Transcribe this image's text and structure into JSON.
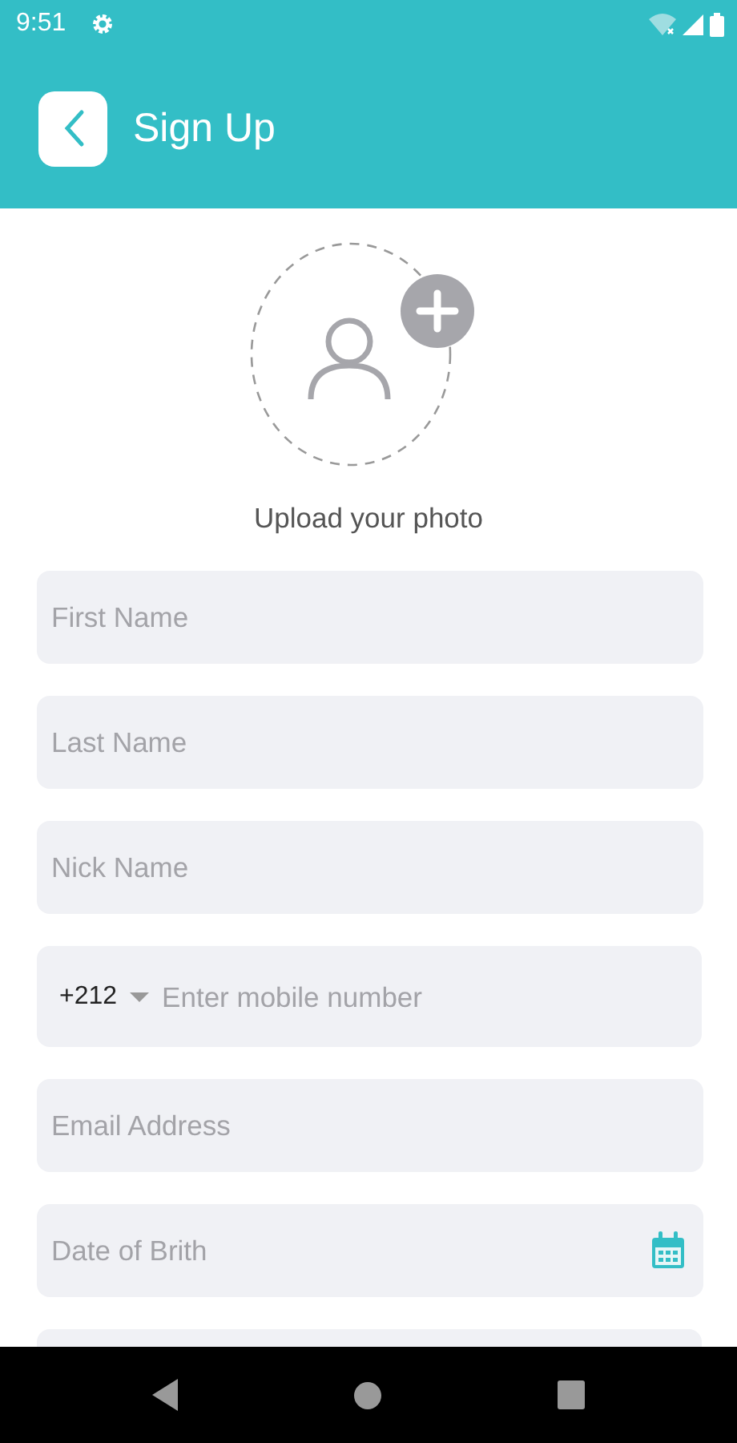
{
  "status_bar": {
    "time": "9:51"
  },
  "header": {
    "title": "Sign Up"
  },
  "photo": {
    "caption": "Upload your photo"
  },
  "fields": [
    {
      "kind": "text",
      "placeholder": "First Name"
    },
    {
      "kind": "text",
      "placeholder": "Last Name"
    },
    {
      "kind": "text",
      "placeholder": "Nick Name"
    },
    {
      "kind": "phone",
      "code": "+212",
      "placeholder": "Enter mobile number"
    },
    {
      "kind": "text",
      "placeholder": "Email Address"
    },
    {
      "kind": "date",
      "placeholder": "Date of Brith"
    },
    {
      "kind": "cut"
    }
  ]
}
